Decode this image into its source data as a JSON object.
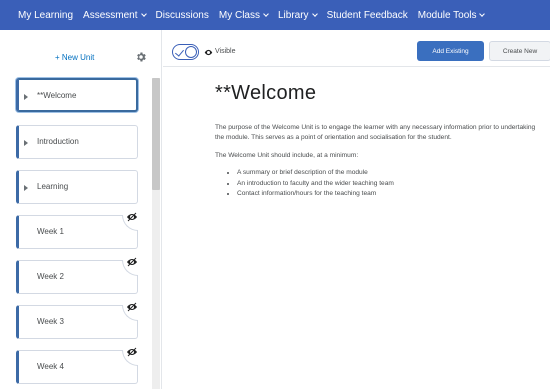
{
  "nav": {
    "items": [
      {
        "label": "My Learning",
        "dropdown": false
      },
      {
        "label": "Assessment",
        "dropdown": true
      },
      {
        "label": "Discussions",
        "dropdown": false
      },
      {
        "label": "My Class",
        "dropdown": true
      },
      {
        "label": "Library",
        "dropdown": true
      },
      {
        "label": "Student Feedback",
        "dropdown": false
      },
      {
        "label": "Module Tools",
        "dropdown": true
      }
    ]
  },
  "sidebar": {
    "new_unit_label": "+ New Unit",
    "units": [
      {
        "label": "**Welcome",
        "active": true,
        "hidden": false,
        "caret": true
      },
      {
        "label": "Introduction",
        "active": false,
        "hidden": false,
        "caret": true
      },
      {
        "label": "Learning",
        "active": false,
        "hidden": false,
        "caret": true
      },
      {
        "label": "Week 1",
        "active": false,
        "hidden": true,
        "caret": false
      },
      {
        "label": "Week 2",
        "active": false,
        "hidden": true,
        "caret": false
      },
      {
        "label": "Week 3",
        "active": false,
        "hidden": true,
        "caret": false
      },
      {
        "label": "Week 4",
        "active": false,
        "hidden": true,
        "caret": false
      }
    ]
  },
  "toolbar": {
    "visible_label": "Visible",
    "add_existing_label": "Add Existing",
    "create_new_label": "Create New"
  },
  "main": {
    "title": "**Welcome",
    "paragraph1": "The purpose of the Welcome Unit is to engage the learner with any necessary information prior to undertaking the module. This serves as a point of orientation and socialisation for the student.",
    "paragraph2": "The Welcome Unit should include, at a minimum:",
    "bullets": [
      "A summary or brief description of the module",
      "An introduction to faculty and the wider teaching team",
      "Contact information/hours for the teaching team"
    ]
  },
  "colors": {
    "nav_bg": "#3a5fb8",
    "accent": "#3a6fbf"
  }
}
